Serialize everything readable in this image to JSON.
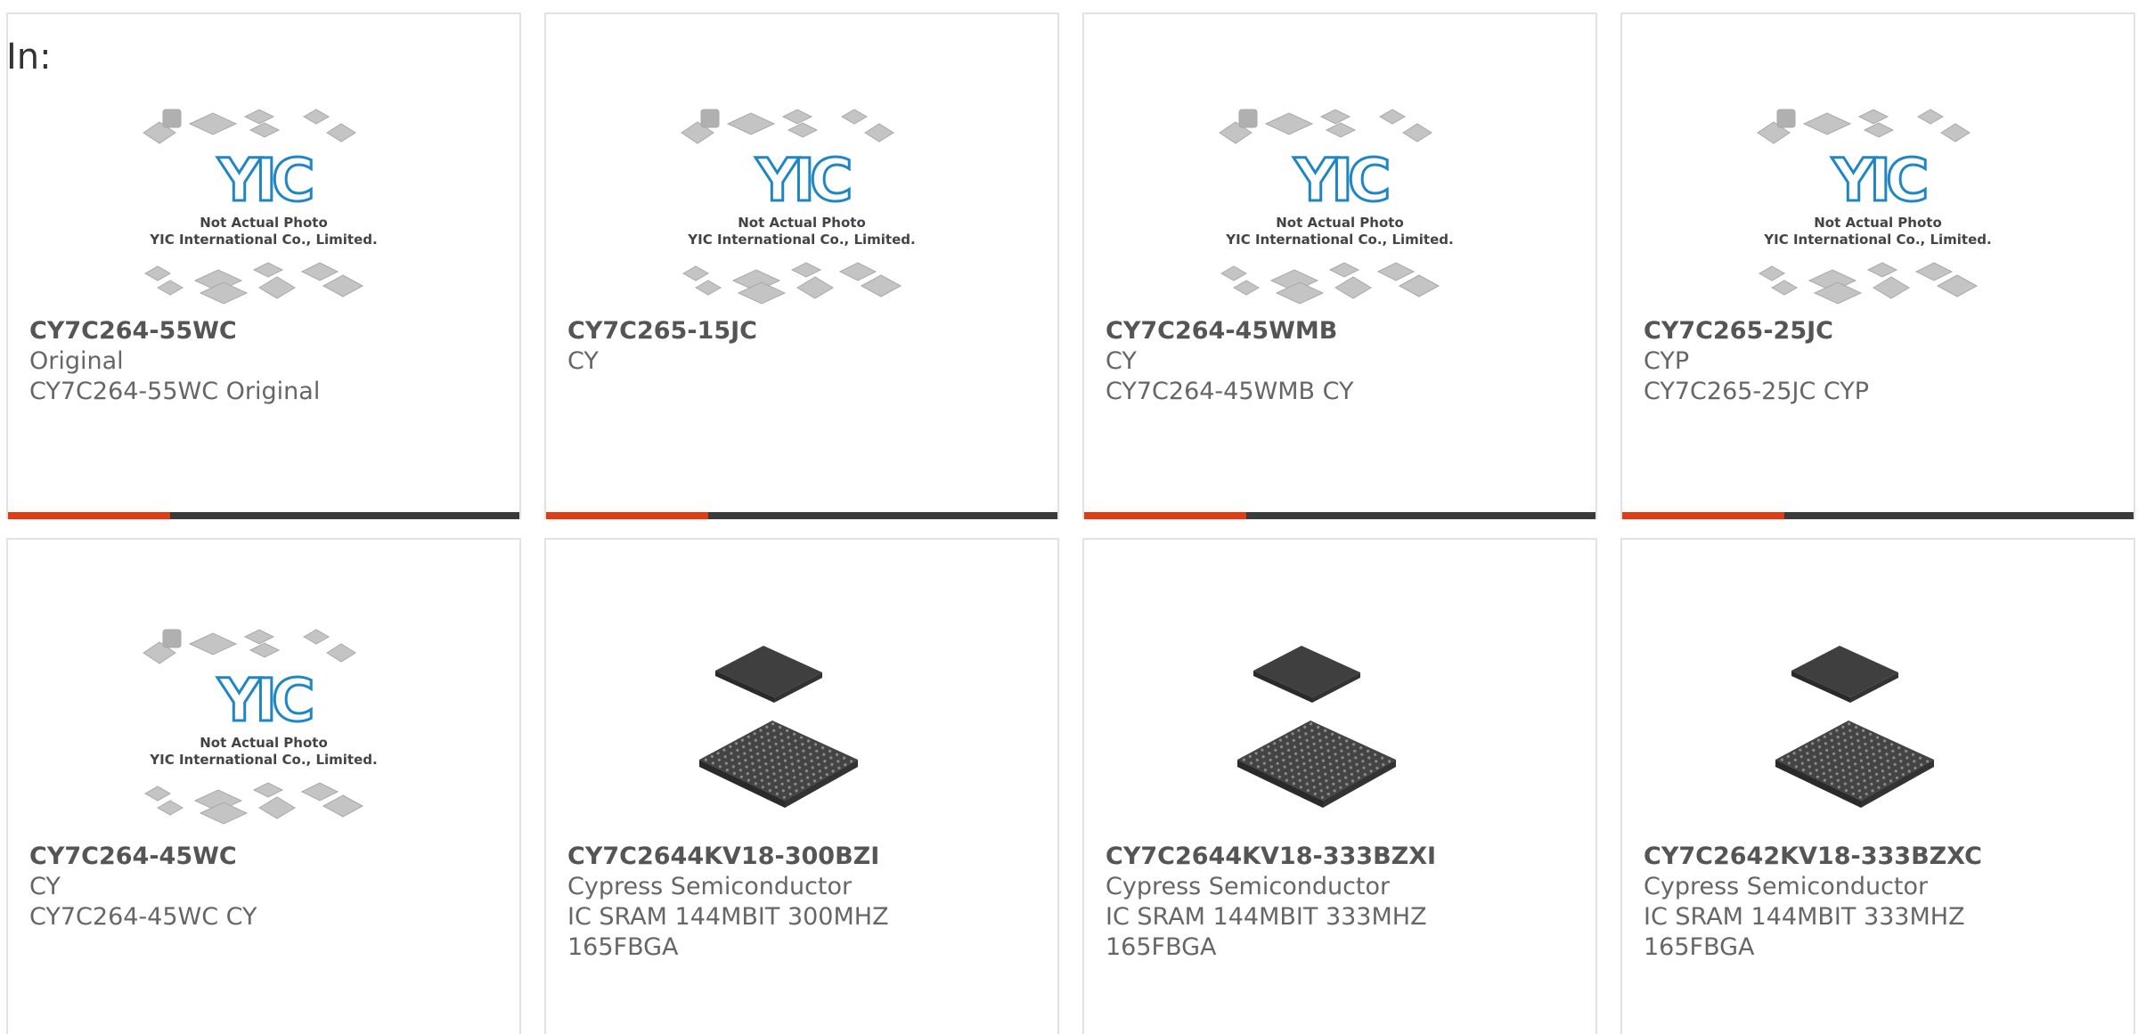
{
  "filter_label": "In:",
  "placeholder_image": {
    "watermark_line1": "Not Actual Photo",
    "watermark_line2": "YIC International Co., Limited.",
    "logo_text": "YIC",
    "logo_color": "#1f86c6"
  },
  "accent_color": "#e23b14",
  "products": [
    {
      "part": "CY7C264-55WC",
      "line1": "Original",
      "line2": "CY7C264-55WC Original",
      "line3": "",
      "image": "placeholder"
    },
    {
      "part": "CY7C265-15JC",
      "line1": "CY",
      "line2": "",
      "line3": "",
      "image": "placeholder"
    },
    {
      "part": "CY7C264-45WMB",
      "line1": "CY",
      "line2": "CY7C264-45WMB CY",
      "line3": "",
      "image": "placeholder"
    },
    {
      "part": "CY7C265-25JC",
      "line1": "CYP",
      "line2": "CY7C265-25JC CYP",
      "line3": "",
      "image": "placeholder"
    },
    {
      "part": "CY7C264-45WC",
      "line1": "CY",
      "line2": "CY7C264-45WC CY",
      "line3": "",
      "image": "placeholder"
    },
    {
      "part": "CY7C2644KV18-300BZI",
      "line1": "Cypress Semiconductor",
      "line2": "IC SRAM 144MBIT 300MHZ",
      "line3": "165FBGA",
      "image": "bga-chip"
    },
    {
      "part": "CY7C2644KV18-333BZXI",
      "line1": "Cypress Semiconductor",
      "line2": "IC SRAM 144MBIT 333MHZ",
      "line3": "165FBGA",
      "image": "bga-chip"
    },
    {
      "part": "CY7C2642KV18-333BZXC",
      "line1": "Cypress Semiconductor",
      "line2": "IC SRAM 144MBIT 333MHZ",
      "line3": "165FBGA",
      "image": "bga-chip"
    }
  ]
}
